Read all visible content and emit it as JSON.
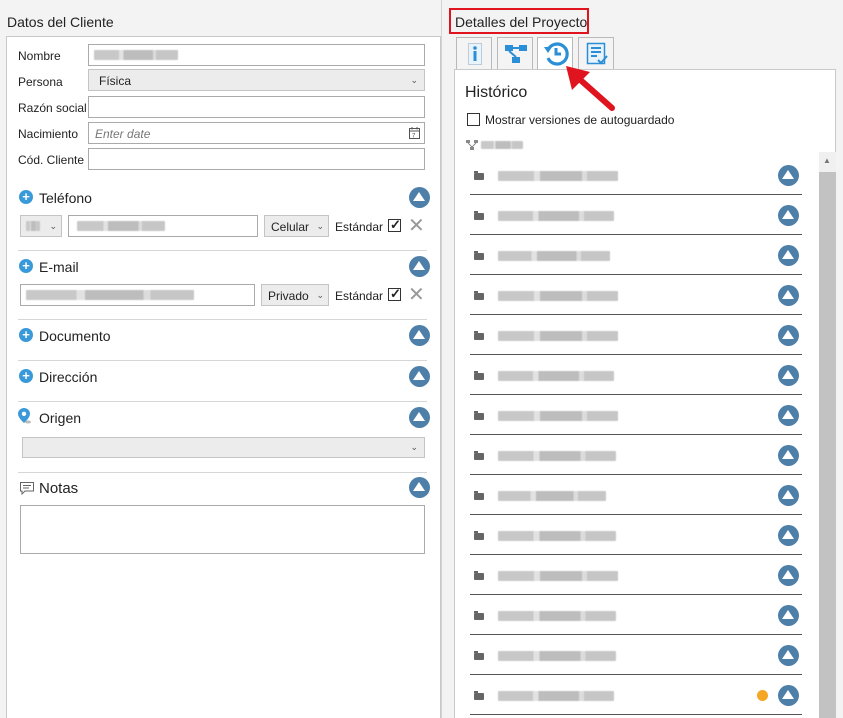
{
  "left": {
    "title": "Datos del Cliente",
    "fields": {
      "nombre_label": "Nombre",
      "persona_label": "Persona",
      "persona_value": "Física",
      "razon_label": "Razón social",
      "nacimiento_label": "Nacimiento",
      "nacimiento_placeholder": "Enter date",
      "cod_label": "Cód. Cliente"
    },
    "telefono": {
      "title": "Teléfono",
      "type": "Celular",
      "standard": "Estándar"
    },
    "email": {
      "title": "E-mail",
      "type": "Privado",
      "standard": "Estándar"
    },
    "documento": {
      "title": "Documento"
    },
    "direccion": {
      "title": "Dirección"
    },
    "origen": {
      "title": "Origen"
    },
    "notas": {
      "title": "Notas"
    }
  },
  "right": {
    "title": "Detalles del Proyecto",
    "tabs": [
      {
        "icon": "info-icon"
      },
      {
        "icon": "hierarchy-icon"
      },
      {
        "icon": "history-icon"
      },
      {
        "icon": "checklist-icon"
      }
    ],
    "history": {
      "heading": "Histórico",
      "checkbox_label": "Mostrar versiones de autoguardado"
    }
  },
  "colors": {
    "highlight": "#e0141e",
    "accent_blue": "#3a9ad9",
    "collapse_btn": "#4d7fa8",
    "dot_orange": "#f5a623"
  }
}
